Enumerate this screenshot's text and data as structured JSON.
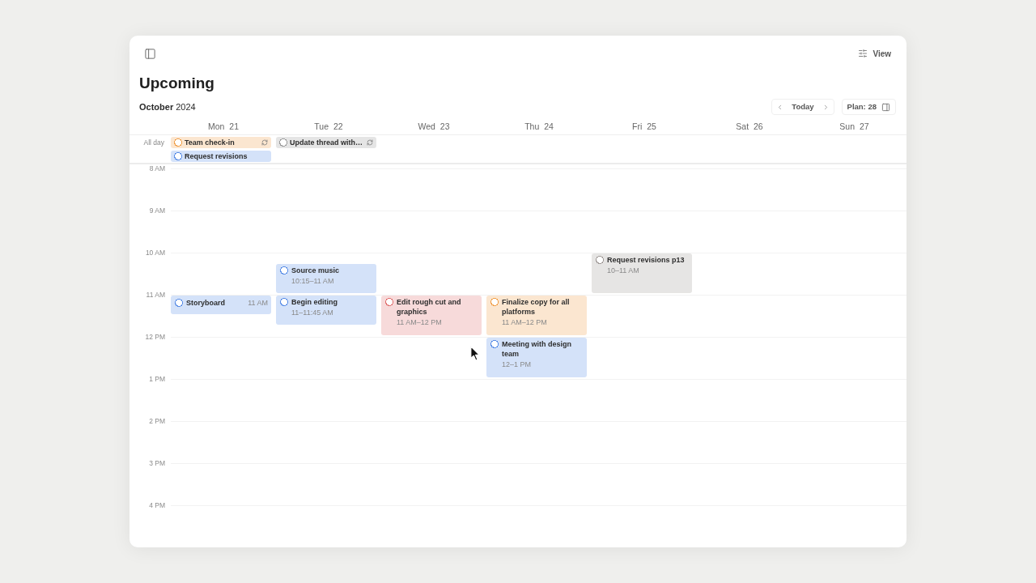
{
  "top_bar": {
    "view_button": "View"
  },
  "header": {
    "title": "Upcoming",
    "month": "**October** 2024",
    "today_button": "Today",
    "plan_button": "Plan: 28"
  },
  "all_day_label": "All day",
  "hours": [
    "8 AM",
    "9 AM",
    "10 AM",
    "11 AM",
    "12 PM",
    "1 PM",
    "2 PM",
    "3 PM",
    "4 PM"
  ],
  "days": [
    {
      "label": "Mon 21",
      "all_day": [
        {
          "title": "Team check-in",
          "color": "#f0a04b",
          "checked": false,
          "recurring": true
        },
        {
          "title": "Request revisions",
          "color": "#5b8ee6",
          "checked": false,
          "recurring": false
        }
      ],
      "events": [
        {
          "kind": "short",
          "title": "Storyboard",
          "time": "11 AM",
          "color": "#5b8ee6",
          "checked": false
        }
      ]
    },
    {
      "label": "Tue 22",
      "all_day": [
        {
          "title": "Update thread with…",
          "color": "#9b9b9b",
          "checked": false,
          "recurring": true
        }
      ],
      "events": [
        {
          "kind": "block",
          "title": "Source music",
          "time": "10:15–11 AM",
          "color": "#5b8ee6",
          "checked": false
        },
        {
          "kind": "block",
          "title": "Begin editing",
          "time": "11–11:45 AM",
          "color": "#5b8ee6",
          "checked": false
        }
      ]
    },
    {
      "label": "Wed 23",
      "events": [
        {
          "kind": "block",
          "title": "Edit rough cut and graphics",
          "time": "11 AM–12 PM",
          "color": "#e0706f",
          "checked": false
        }
      ]
    },
    {
      "label": "Thu 24",
      "events": [
        {
          "kind": "block",
          "title": "Finalize copy for all platforms",
          "time": "11 AM–12 PM",
          "color": "#f0a04b",
          "checked": false
        },
        {
          "kind": "block",
          "title": "Meeting with design team",
          "time": "12–1 PM",
          "color": "#5b8ee6",
          "checked": false
        }
      ]
    },
    {
      "label": "Fri 25",
      "events": [
        {
          "kind": "block",
          "title": "Request revisions p13",
          "time": "10–11 AM",
          "color": "#a09a98",
          "checked": false
        }
      ]
    },
    {
      "label": "Sat 26"
    },
    {
      "label": "Sun 27"
    }
  ]
}
